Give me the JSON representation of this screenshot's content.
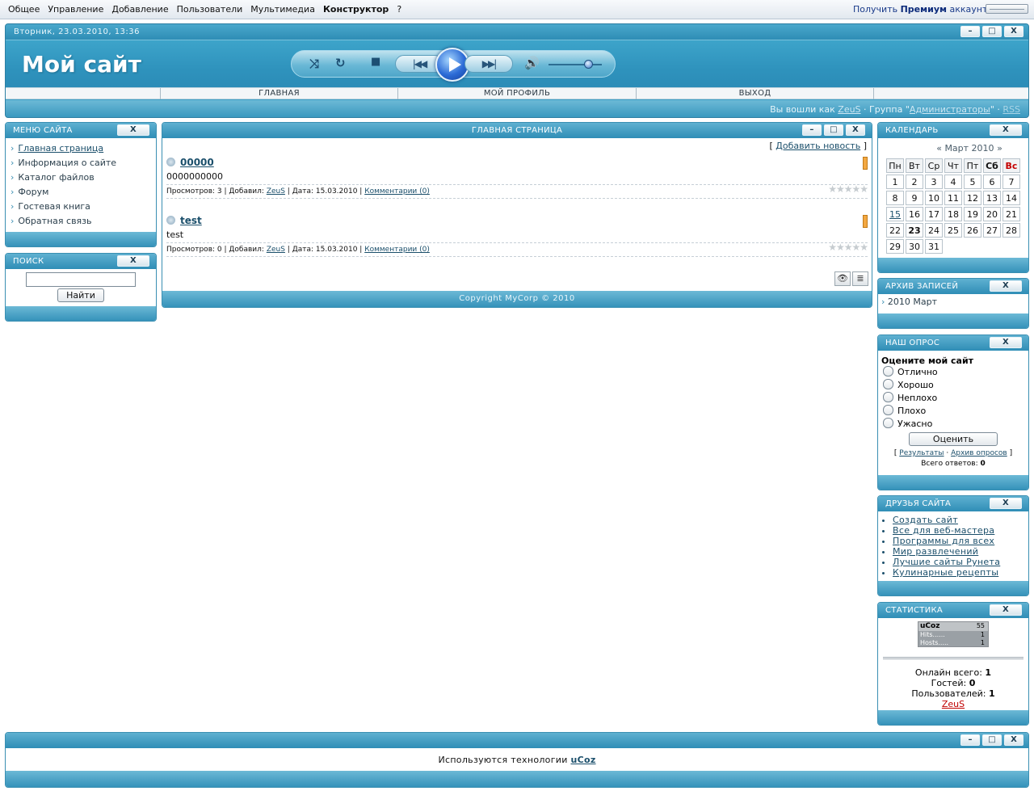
{
  "adminbar": {
    "menu": [
      "Общее",
      "Управление",
      "Добавление",
      "Пользователи",
      "Мультимедиа",
      "Конструктор",
      "?"
    ],
    "premium_prefix": "Получить",
    "premium_bold": "Премиум",
    "premium_suffix": "аккаунт"
  },
  "header": {
    "datetime": "Вторник, 23.03.2010, 13:36",
    "site_title": "Мой сайт",
    "nav": [
      "ГЛАВНАЯ",
      "МОЙ ПРОФИЛЬ",
      "ВЫХОД"
    ],
    "login_prefix": "Вы вошли как",
    "login_user": "ZeuS",
    "login_group_prefix": "· Группа \"",
    "login_group": "Администраторы",
    "login_group_suffix": "\" ·",
    "rss": "RSS"
  },
  "window_buttons": {
    "min": "–",
    "max": "□",
    "close": "X"
  },
  "sitemenu": {
    "title": "МЕНЮ САЙТА",
    "items": [
      "Главная страница",
      "Информация о сайте",
      "Каталог файлов",
      "Форум",
      "Гостевая книга",
      "Обратная связь"
    ]
  },
  "search": {
    "title": "ПОИСК",
    "button": "Найти",
    "value": ""
  },
  "main": {
    "title": "ГЛАВНАЯ СТРАНИЦА",
    "add_news": "Добавить новость",
    "news": [
      {
        "title": "00000",
        "text": "0000000000",
        "views": "Просмотров: 3",
        "author_label": "Добавил:",
        "author": "ZeuS",
        "date": "Дата: 15.03.2010",
        "comments": "Комментарии (0)"
      },
      {
        "title": "test",
        "text": "test",
        "views": "Просмотров: 0",
        "author_label": "Добавил:",
        "author": "ZeuS",
        "date": "Дата: 15.03.2010",
        "comments": "Комментарии (0)"
      }
    ],
    "copyright": "Copyright MyCorp © 2010"
  },
  "calendar": {
    "title": "КАЛЕНДАРЬ",
    "prev": "«",
    "month": "Март 2010",
    "next": "»",
    "days": [
      "Пн",
      "Вт",
      "Ср",
      "Чт",
      "Пт",
      "Сб",
      "Вс"
    ],
    "weeks": [
      [
        "1",
        "2",
        "3",
        "4",
        "5",
        "6",
        "7"
      ],
      [
        "8",
        "9",
        "10",
        "11",
        "12",
        "13",
        "14"
      ],
      [
        "15",
        "16",
        "17",
        "18",
        "19",
        "20",
        "21"
      ],
      [
        "22",
        "23",
        "24",
        "25",
        "26",
        "27",
        "28"
      ],
      [
        "29",
        "30",
        "31",
        "",
        "",
        "",
        ""
      ]
    ]
  },
  "archive": {
    "title": "АРХИВ ЗАПИСЕЙ",
    "items": [
      "2010 Март"
    ]
  },
  "poll": {
    "title": "НАШ ОПРОС",
    "question": "Оцените мой сайт",
    "options": [
      "Отлично",
      "Хорошо",
      "Неплохо",
      "Плохо",
      "Ужасно"
    ],
    "button": "Оценить",
    "results": "Результаты",
    "archive": "Архив опросов",
    "total_label": "Всего ответов:",
    "total": "0"
  },
  "friends": {
    "title": "ДРУЗЬЯ САЙТА",
    "items": [
      "Создать сайт",
      "Все для веб-мастера",
      "Программы для всех",
      "Мир развлечений",
      "Лучшие сайты Рунета",
      "Кулинарные рецепты"
    ]
  },
  "stats": {
    "title": "СТАТИСТИКА",
    "counter_brand": "uCoz",
    "counter_value": "55",
    "counter_hits_label": "Hits......",
    "counter_hits": "1",
    "counter_hosts_label": "Hosts.....",
    "counter_hosts": "1",
    "online_label": "Онлайн всего:",
    "online": "1",
    "guests_label": "Гостей:",
    "guests": "0",
    "users_label": "Пользователей:",
    "users": "1",
    "user": "ZeuS"
  },
  "footer": {
    "text": "Используются технологии",
    "link": "uCoz"
  }
}
